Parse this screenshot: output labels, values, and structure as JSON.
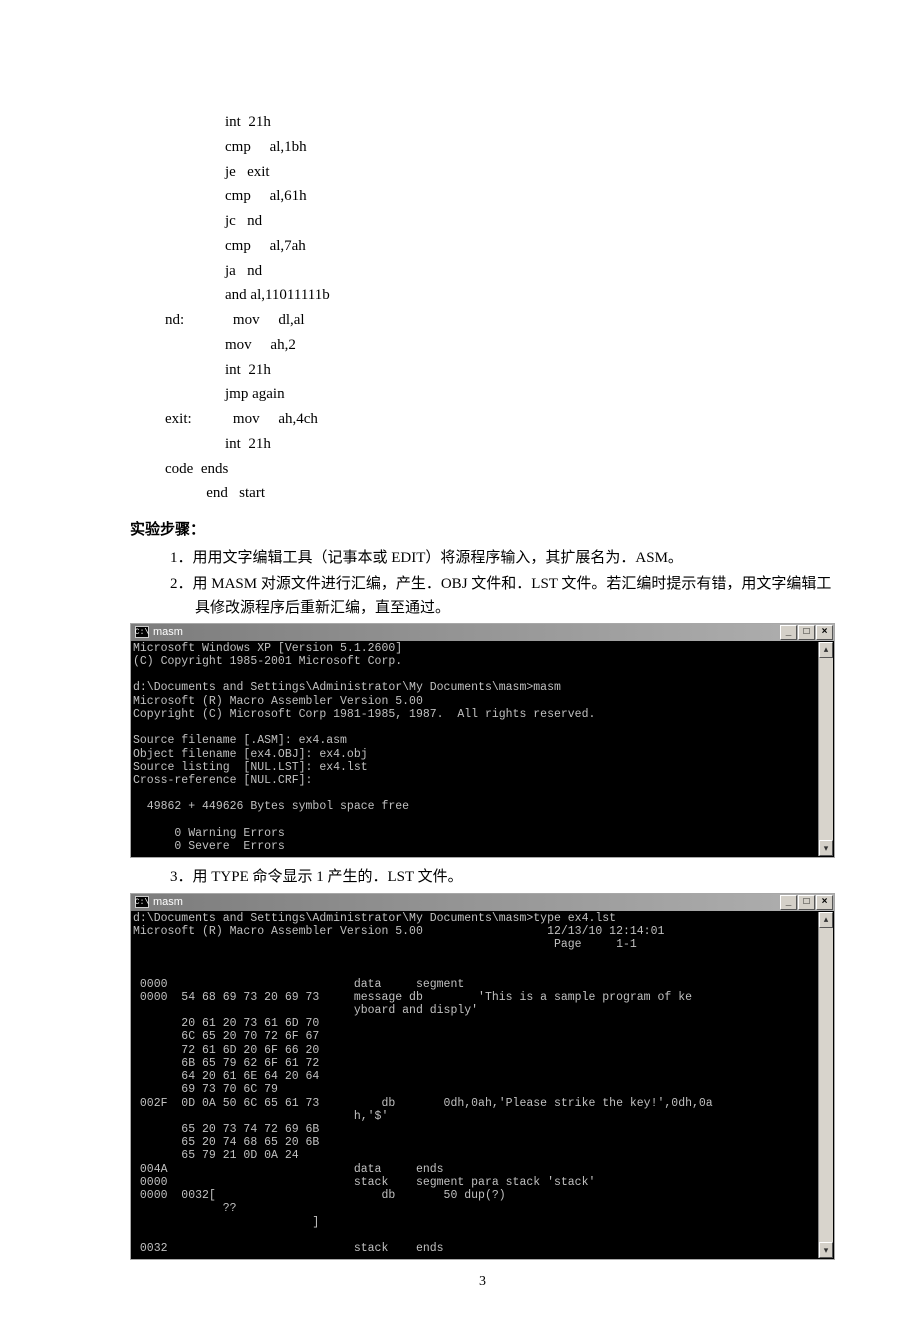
{
  "source_code": "                int  21h\n                cmp     al,1bh\n                je   exit\n                cmp     al,61h\n                jc   nd\n                cmp     al,7ah\n                ja   nd\n                and al,11011111b\nnd:             mov     dl,al\n                mov     ah,2\n                int  21h\n                jmp again\nexit:           mov     ah,4ch\n                int  21h\ncode  ends\n           end   start",
  "section_title": "实验步骤：",
  "steps": {
    "s1": "1．用用文字编辑工具（记事本或 EDIT）将源程序输入，其扩展名为．ASM。",
    "s2": "2．用 MASM 对源文件进行汇编，产生．OBJ 文件和．LST 文件。若汇编时提示有错，用文字编辑工具修改源程序后重新汇编，直至通过。",
    "s3": "3．用 TYPE 命令显示 1 产生的．LST 文件。"
  },
  "console1": {
    "title": "masm",
    "text": "Microsoft Windows XP [Version 5.1.2600]\n(C) Copyright 1985-2001 Microsoft Corp.\n\nd:\\Documents and Settings\\Administrator\\My Documents\\masm>masm\nMicrosoft (R) Macro Assembler Version 5.00\nCopyright (C) Microsoft Corp 1981-1985, 1987.  All rights reserved.\n\nSource filename [.ASM]: ex4.asm\nObject filename [ex4.OBJ]: ex4.obj\nSource listing  [NUL.LST]: ex4.lst\nCross-reference [NUL.CRF]:\n\n  49862 + 449626 Bytes symbol space free\n\n      0 Warning Errors\n      0 Severe  Errors",
    "btn_min": "_",
    "btn_max": "□",
    "btn_close": "×",
    "icon": "C:\\"
  },
  "console2": {
    "title": "masm",
    "text": "d:\\Documents and Settings\\Administrator\\My Documents\\masm>type ex4.lst\nMicrosoft (R) Macro Assembler Version 5.00                  12/13/10 12:14:01\n                                                             Page     1-1\n\n\n 0000                           data     segment\n 0000  54 68 69 73 20 69 73     message db        'This is a sample program of ke\n                                yboard and disply'\n       20 61 20 73 61 6D 70\n       6C 65 20 70 72 6F 67\n       72 61 6D 20 6F 66 20\n       6B 65 79 62 6F 61 72\n       64 20 61 6E 64 20 64\n       69 73 70 6C 79\n 002F  0D 0A 50 6C 65 61 73         db       0dh,0ah,'Please strike the key!',0dh,0a\n                                h,'$'\n       65 20 73 74 72 69 6B\n       65 20 74 68 65 20 6B\n       65 79 21 0D 0A 24\n 004A                           data     ends\n 0000                           stack    segment para stack 'stack'\n 0000  0032[                        db       50 dup(?)\n             ??\n                          ]\n\n 0032                           stack    ends",
    "btn_min": "_",
    "btn_max": "□",
    "btn_close": "×",
    "icon": "C:\\",
    "scroll_up": "▴",
    "scroll_down": "▾"
  },
  "page_number": "3"
}
